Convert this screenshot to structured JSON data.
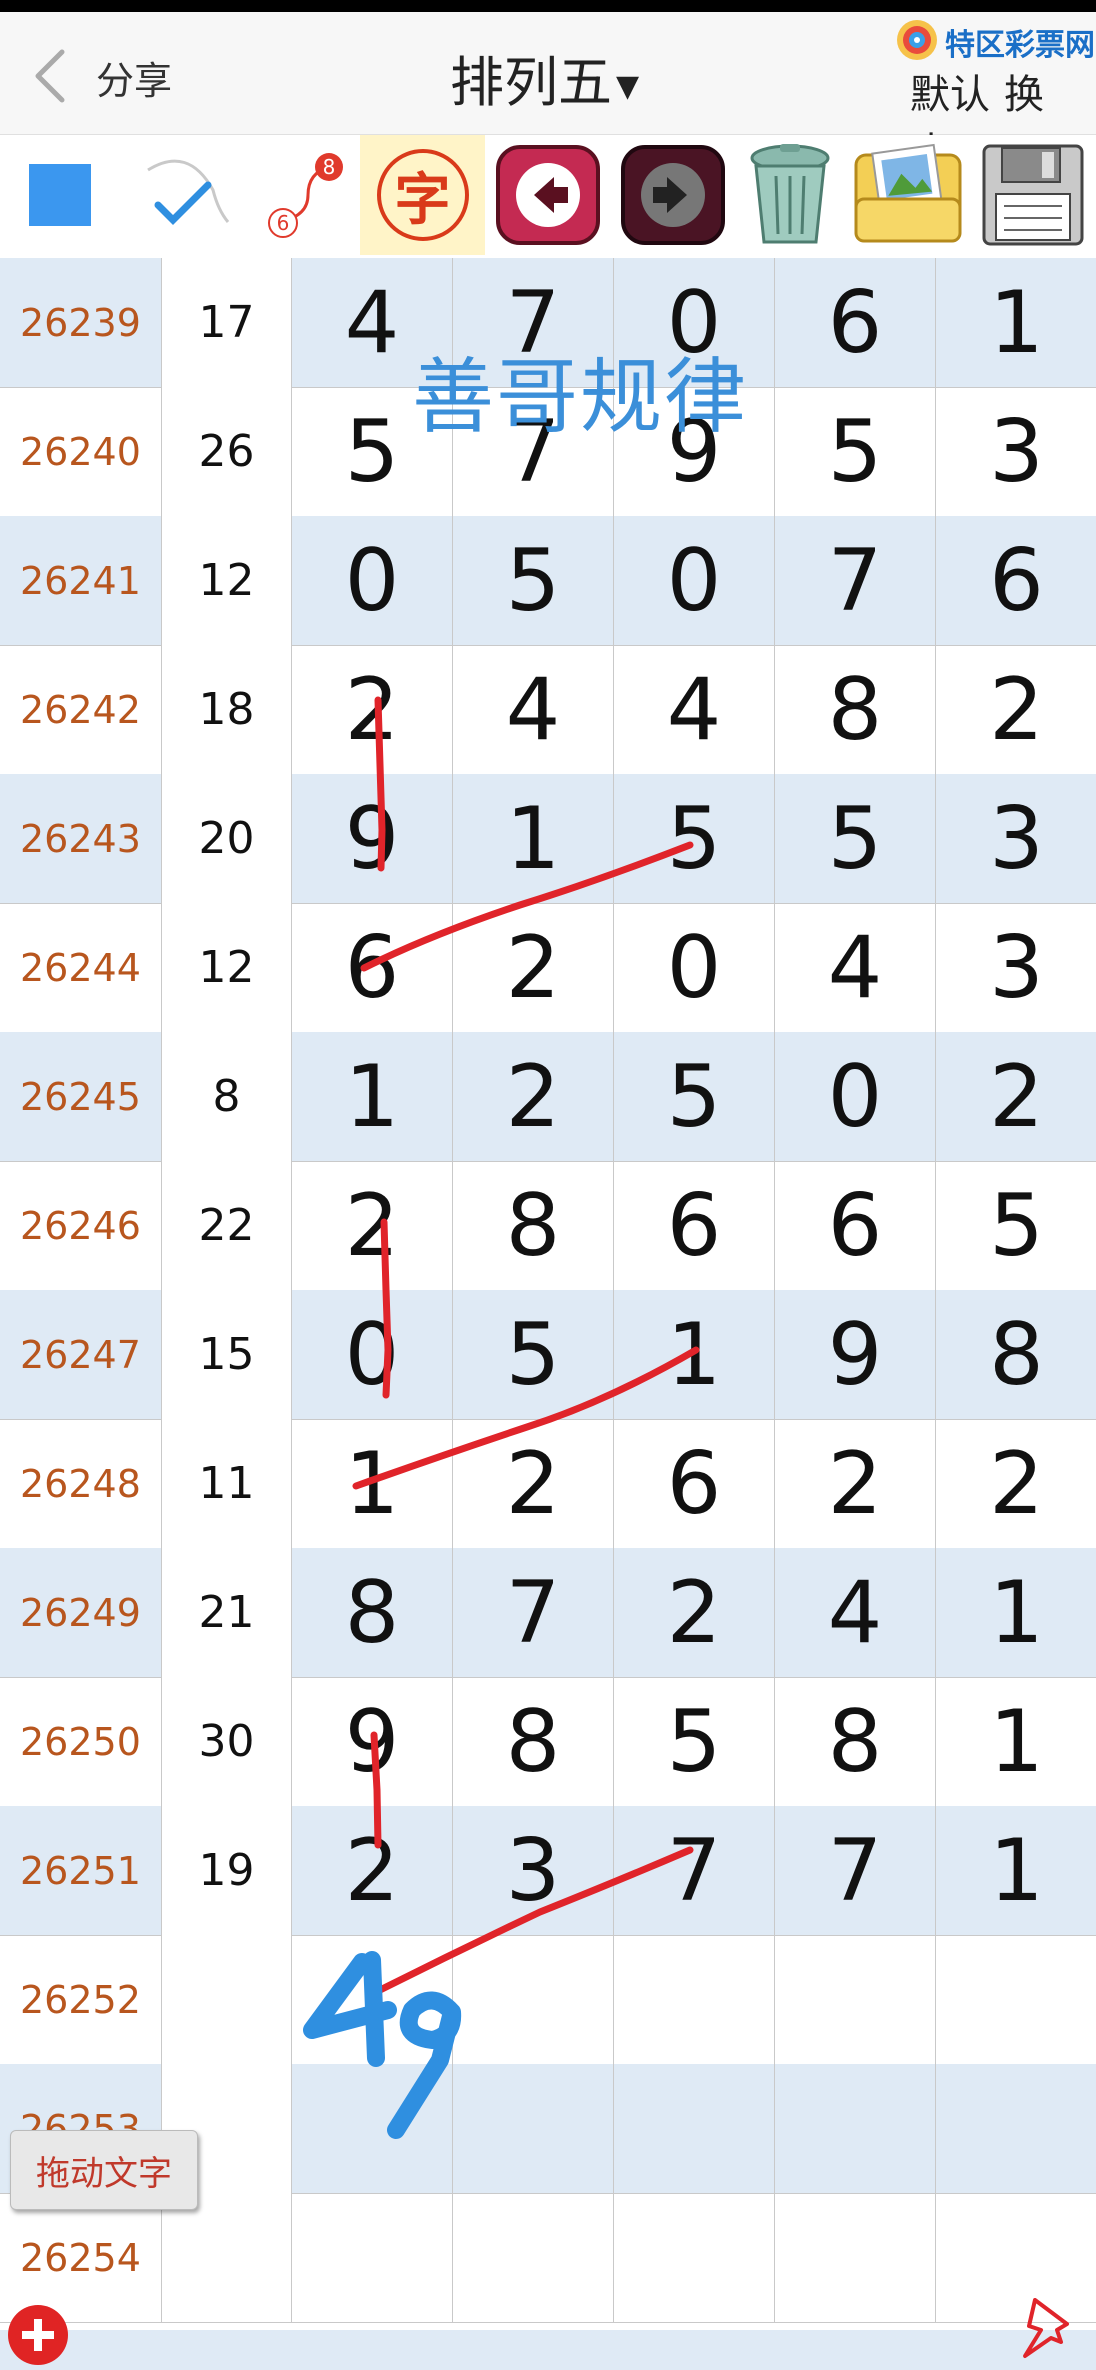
{
  "header": {
    "back_label": "<",
    "share_label": "分享",
    "title": "排列五",
    "logo_text": "特区彩票网",
    "default_label": "默认",
    "skin_label": "换皮"
  },
  "toolbar": {
    "tools": [
      "color-square",
      "pen-tool",
      "connect-tool",
      "text-tool",
      "undo",
      "redo",
      "trash",
      "photos",
      "save"
    ],
    "text_tool_label": "字",
    "connect_top": "8",
    "connect_bottom": "6"
  },
  "watermark": "善哥规律",
  "rows": [
    {
      "issue": "26239",
      "sum": "17",
      "digits": [
        "4",
        "7",
        "0",
        "6",
        "1"
      ]
    },
    {
      "issue": "26240",
      "sum": "26",
      "digits": [
        "5",
        "7",
        "9",
        "5",
        "3"
      ]
    },
    {
      "issue": "26241",
      "sum": "12",
      "digits": [
        "0",
        "5",
        "0",
        "7",
        "6"
      ]
    },
    {
      "issue": "26242",
      "sum": "18",
      "digits": [
        "2",
        "4",
        "4",
        "8",
        "2"
      ]
    },
    {
      "issue": "26243",
      "sum": "20",
      "digits": [
        "9",
        "1",
        "5",
        "5",
        "3"
      ]
    },
    {
      "issue": "26244",
      "sum": "12",
      "digits": [
        "6",
        "2",
        "0",
        "4",
        "3"
      ]
    },
    {
      "issue": "26245",
      "sum": "8",
      "digits": [
        "1",
        "2",
        "5",
        "0",
        "2"
      ]
    },
    {
      "issue": "26246",
      "sum": "22",
      "digits": [
        "2",
        "8",
        "6",
        "6",
        "5"
      ]
    },
    {
      "issue": "26247",
      "sum": "15",
      "digits": [
        "0",
        "5",
        "1",
        "9",
        "8"
      ]
    },
    {
      "issue": "26248",
      "sum": "11",
      "digits": [
        "1",
        "2",
        "6",
        "2",
        "2"
      ]
    },
    {
      "issue": "26249",
      "sum": "21",
      "digits": [
        "8",
        "7",
        "2",
        "4",
        "1"
      ]
    },
    {
      "issue": "26250",
      "sum": "30",
      "digits": [
        "9",
        "8",
        "5",
        "8",
        "1"
      ]
    },
    {
      "issue": "26251",
      "sum": "19",
      "digits": [
        "2",
        "3",
        "7",
        "7",
        "1"
      ]
    },
    {
      "issue": "26252",
      "sum": "",
      "digits": [
        "",
        "",
        "",
        "",
        ""
      ]
    },
    {
      "issue": "26253",
      "sum": "",
      "digits": [
        "",
        "",
        "",
        "",
        ""
      ]
    },
    {
      "issue": "26254",
      "sum": "",
      "digits": [
        "",
        "",
        "",
        "",
        ""
      ]
    }
  ],
  "handwritten_prediction": "49",
  "drag_text_label": "拖动文字",
  "colors": {
    "issue_text": "#b8561e",
    "row_alt_bg": "#dfeaf5",
    "group_divider": "#b85c2a",
    "annotation_red": "#e0242a",
    "annotation_blue": "#2f8fe0",
    "watermark": "#3b8fd9"
  }
}
